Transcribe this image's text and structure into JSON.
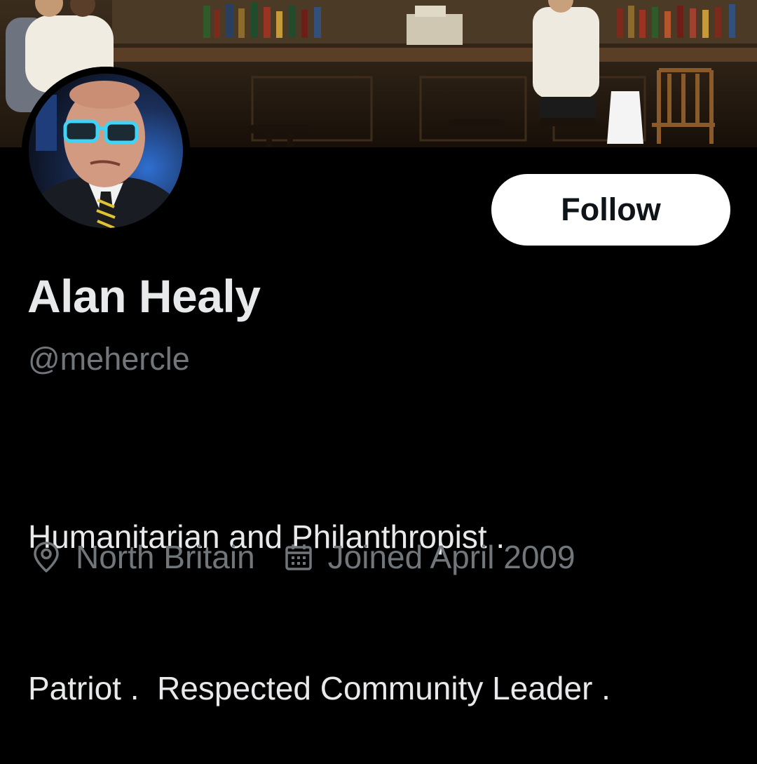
{
  "profile": {
    "display_name": "Alan Healy",
    "handle": "@mehercle",
    "bio_lines": [
      "Humanitarian and Philanthropist .",
      "Patriot .  Respected Community Leader ."
    ],
    "location": "North Britain",
    "joined": "Joined April 2009"
  },
  "actions": {
    "follow_label": "Follow"
  },
  "icons": {
    "location": "map-pin-icon",
    "joined": "calendar-icon"
  },
  "colors": {
    "background": "#000000",
    "primary_text": "#e7e9ea",
    "secondary_text": "#71767b",
    "follow_button_bg": "#ffffff",
    "follow_button_text": "#0f1419"
  }
}
